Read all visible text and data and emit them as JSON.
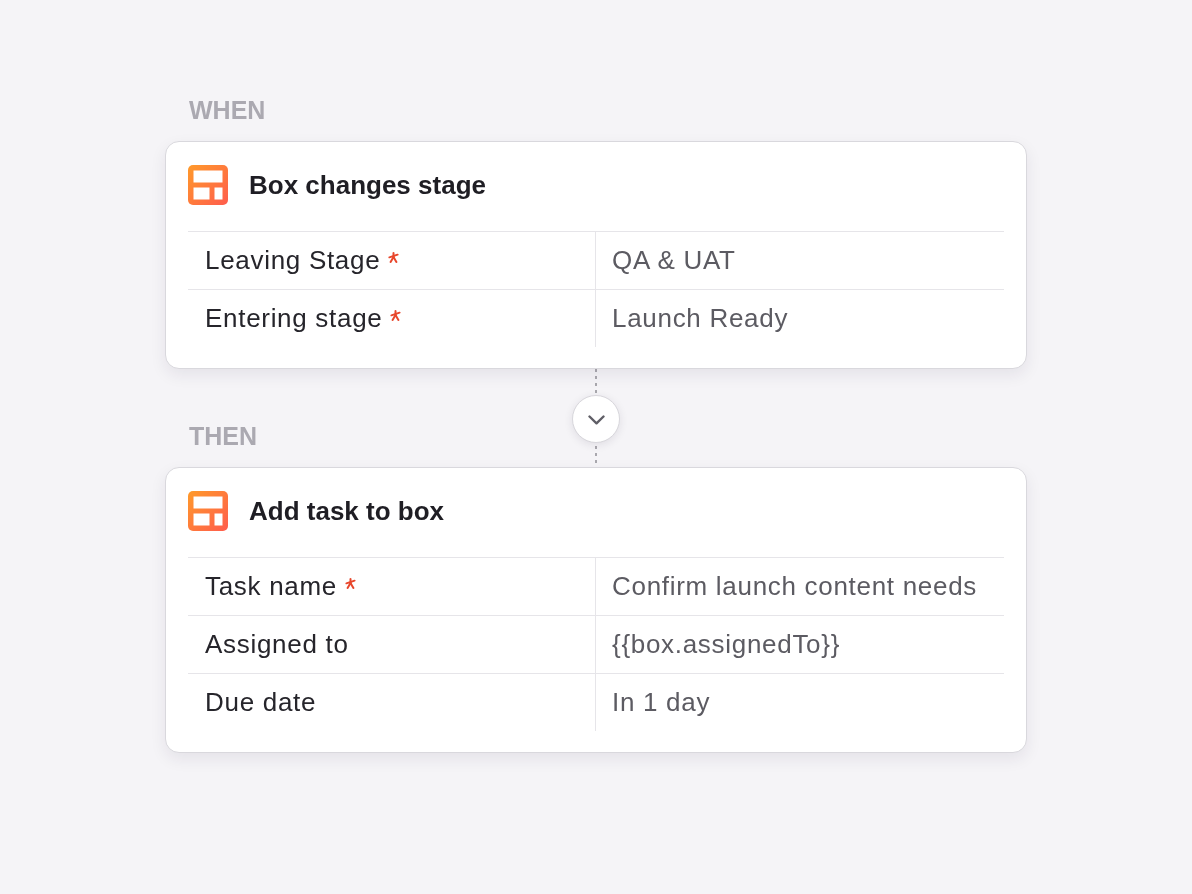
{
  "sections": [
    {
      "label": "WHEN",
      "card": {
        "title": "Box changes stage",
        "fields": [
          {
            "label": "Leaving Stage",
            "required": true,
            "value": "QA & UAT"
          },
          {
            "label": "Entering stage",
            "required": true,
            "value": "Launch Ready"
          }
        ]
      }
    },
    {
      "label": "THEN",
      "card": {
        "title": "Add task to box",
        "fields": [
          {
            "label": "Task name",
            "required": true,
            "value": "Confirm launch content needs"
          },
          {
            "label": "Assigned to",
            "required": false,
            "value": "{{box.assignedTo}}"
          },
          {
            "label": "Due date",
            "required": false,
            "value": "In 1 day"
          }
        ]
      }
    }
  ]
}
